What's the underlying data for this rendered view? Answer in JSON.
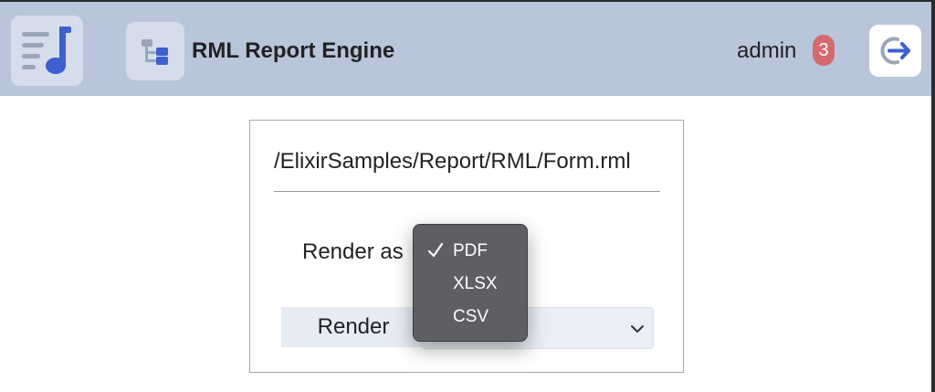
{
  "header": {
    "app_title": "RML Report Engine",
    "user": "admin",
    "notification_count": "3"
  },
  "form": {
    "path": "/ElixirSamples/Report/RML/Form.rml",
    "render_as_label": "Render as",
    "render_button": "Render",
    "format_options": [
      "PDF",
      "XLSX",
      "CSV"
    ],
    "selected_format": "PDF"
  },
  "colors": {
    "header_bg": "#b9c5da",
    "accent": "#3f5fd0",
    "badge": "#d46a6f",
    "menu_bg": "#5e5f62"
  }
}
